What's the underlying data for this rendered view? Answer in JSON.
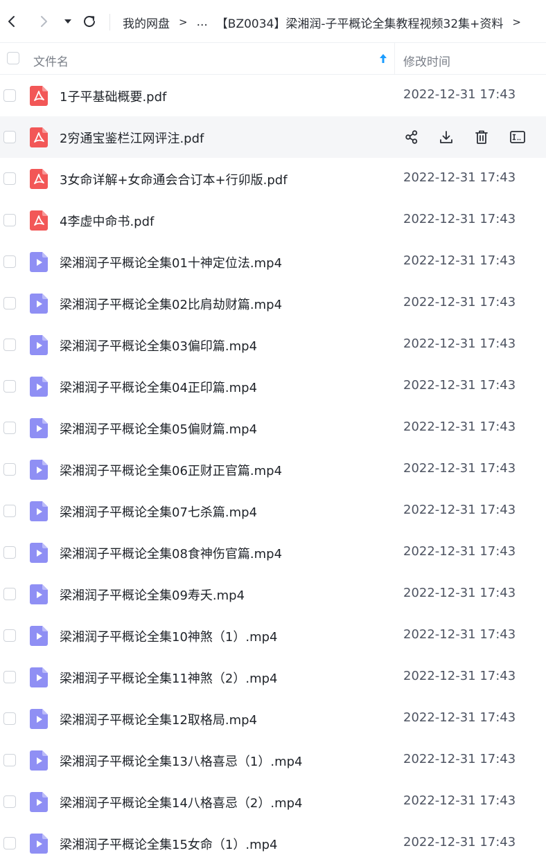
{
  "breadcrumb": [
    "我的网盘",
    "...",
    "【BZ0034】梁湘润-子平概论全集教程视频32集+资料"
  ],
  "header": {
    "name_label": "文件名",
    "time_label": "修改时间"
  },
  "colors": {
    "pdf": "#f25757",
    "video": "#8f8ff4",
    "sort_arrow": "#1a9cff"
  },
  "files": [
    {
      "name": "1子平基础概要.pdf",
      "type": "pdf",
      "modified": "2022-12-31 17:43"
    },
    {
      "name": "2穷通宝鉴栏江网评注.pdf",
      "type": "pdf",
      "modified": "",
      "hovered": true
    },
    {
      "name": "3女命详解+女命通会合订本+行卯版.pdf",
      "type": "pdf",
      "modified": "2022-12-31 17:43"
    },
    {
      "name": "4李虚中命书.pdf",
      "type": "pdf",
      "modified": "2022-12-31 17:43"
    },
    {
      "name": "梁湘润子平概论全集01十神定位法.mp4",
      "type": "video",
      "modified": "2022-12-31 17:43"
    },
    {
      "name": "梁湘润子平概论全集02比肩劫财篇.mp4",
      "type": "video",
      "modified": "2022-12-31 17:43"
    },
    {
      "name": "梁湘润子平概论全集03偏印篇.mp4",
      "type": "video",
      "modified": "2022-12-31 17:43"
    },
    {
      "name": "梁湘润子平概论全集04正印篇.mp4",
      "type": "video",
      "modified": "2022-12-31 17:43"
    },
    {
      "name": "梁湘润子平概论全集05偏财篇.mp4",
      "type": "video",
      "modified": "2022-12-31 17:43"
    },
    {
      "name": "梁湘润子平概论全集06正财正官篇.mp4",
      "type": "video",
      "modified": "2022-12-31 17:43"
    },
    {
      "name": "梁湘润子平概论全集07七杀篇.mp4",
      "type": "video",
      "modified": "2022-12-31 17:43"
    },
    {
      "name": "梁湘润子平概论全集08食神伤官篇.mp4",
      "type": "video",
      "modified": "2022-12-31 17:43"
    },
    {
      "name": "梁湘润子平概论全集09寿夭.mp4",
      "type": "video",
      "modified": "2022-12-31 17:43"
    },
    {
      "name": "梁湘润子平概论全集10神煞（1）.mp4",
      "type": "video",
      "modified": "2022-12-31 17:43"
    },
    {
      "name": "梁湘润子平概论全集11神煞（2）.mp4",
      "type": "video",
      "modified": "2022-12-31 17:43"
    },
    {
      "name": "梁湘润子平概论全集12取格局.mp4",
      "type": "video",
      "modified": "2022-12-31 17:43"
    },
    {
      "name": "梁湘润子平概论全集13八格喜忌（1）.mp4",
      "type": "video",
      "modified": "2022-12-31 17:43"
    },
    {
      "name": "梁湘润子平概论全集14八格喜忌（2）.mp4",
      "type": "video",
      "modified": "2022-12-31 17:43"
    },
    {
      "name": "梁湘润子平概论全集15女命（1）.mp4",
      "type": "video",
      "modified": "2022-12-31 17:43"
    }
  ],
  "icons": {
    "back": "chevron-left-icon",
    "forward": "chevron-right-icon",
    "dropdown": "caret-down-icon",
    "refresh": "refresh-icon",
    "share": "share-icon",
    "download": "download-icon",
    "delete": "trash-icon",
    "rename": "rename-icon"
  }
}
